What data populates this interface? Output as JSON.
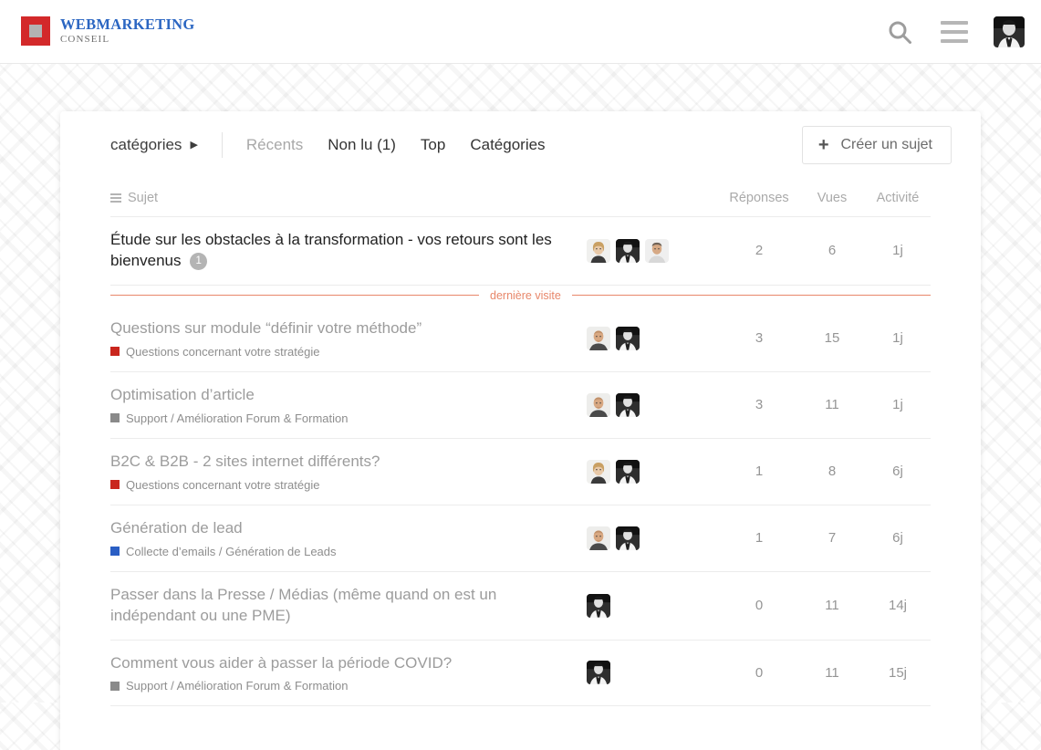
{
  "header": {
    "logo": {
      "mark_color": "#d3292a",
      "mark_inner_color": "#b3b3b3",
      "title": "WEBMARKETING",
      "subtitle": "CONSEIL",
      "title_color": "#2b66c2"
    },
    "search_icon": "search-icon",
    "menu_icon": "hamburger-menu-icon",
    "avatar_icon": "user-avatar"
  },
  "nav": {
    "categories_dropdown": "catégories",
    "caret": "▶",
    "tabs": [
      {
        "label": "Récents",
        "muted": true
      },
      {
        "label": "Non lu (1)",
        "muted": false
      },
      {
        "label": "Top",
        "muted": false
      },
      {
        "label": "Catégories",
        "muted": false
      }
    ],
    "create_button": {
      "plus": "+",
      "label": "Créer un sujet"
    }
  },
  "table": {
    "headers": {
      "subject": "Sujet",
      "replies": "Réponses",
      "views": "Vues",
      "activity": "Activité"
    },
    "last_visit_label": "dernière visite",
    "last_visit_color": "#e8876a",
    "rows": [
      {
        "title": "Étude sur les obstacles à la transformation - vos retours sont les bienvenus",
        "badge": "1",
        "category": null,
        "category_color": null,
        "unread": true,
        "posters": [
          "woman-blonde",
          "man-dark-suit",
          "man-grey-shirt"
        ],
        "replies": "2",
        "views": "6",
        "activity": "1j"
      },
      {
        "title": "Questions sur module “définir votre méthode”",
        "badge": null,
        "category": "Questions concernant votre stratégie",
        "category_color": "#c9261d",
        "unread": false,
        "posters": [
          "man-bald",
          "man-dark-suit"
        ],
        "replies": "3",
        "views": "15",
        "activity": "1j"
      },
      {
        "title": "Optimisation d’article",
        "badge": null,
        "category": "Support / Amélioration Forum & Formation",
        "category_color": "#8a8a8a",
        "unread": false,
        "posters": [
          "man-bald",
          "man-dark-suit"
        ],
        "replies": "3",
        "views": "11",
        "activity": "1j"
      },
      {
        "title": "B2C & B2B - 2 sites internet différents?",
        "badge": null,
        "category": "Questions concernant votre stratégie",
        "category_color": "#c9261d",
        "unread": false,
        "posters": [
          "woman-blonde",
          "man-dark-suit"
        ],
        "replies": "1",
        "views": "8",
        "activity": "6j"
      },
      {
        "title": "Génération de lead",
        "badge": null,
        "category": "Collecte d’emails / Génération de Leads",
        "category_color": "#2a5ec4",
        "unread": false,
        "posters": [
          "man-bald",
          "man-dark-suit"
        ],
        "replies": "1",
        "views": "7",
        "activity": "6j"
      },
      {
        "title": "Passer dans la Presse / Médias (même quand on est un indépendant ou une PME)",
        "badge": null,
        "category": null,
        "category_color": null,
        "unread": false,
        "posters": [
          "man-dark-suit"
        ],
        "replies": "0",
        "views": "11",
        "activity": "14j"
      },
      {
        "title": "Comment vous aider à passer la période COVID?",
        "badge": null,
        "category": "Support / Amélioration Forum & Formation",
        "category_color": "#8a8a8a",
        "unread": false,
        "posters": [
          "man-dark-suit"
        ],
        "replies": "0",
        "views": "11",
        "activity": "15j"
      }
    ]
  }
}
